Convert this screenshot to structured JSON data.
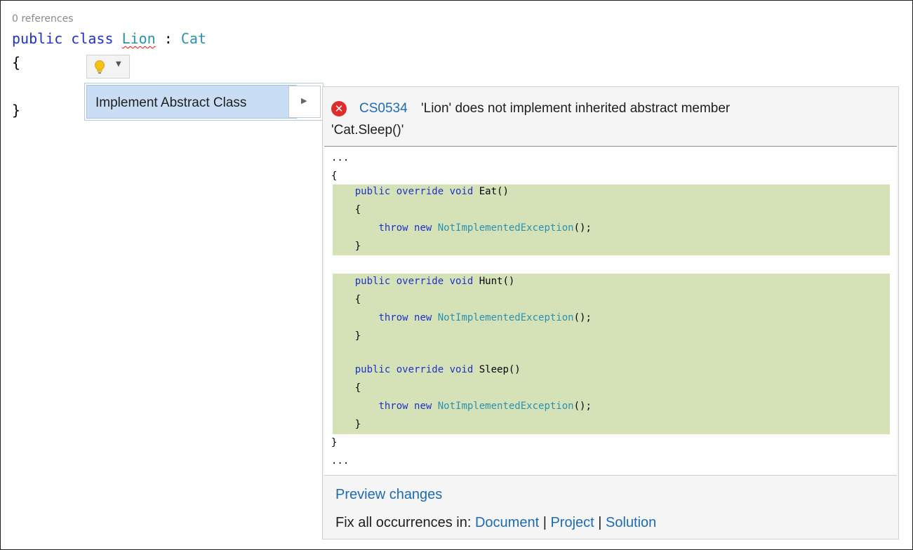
{
  "editor": {
    "codelens": "0 references",
    "lines": {
      "l1_kw1": "public",
      "l1_kw2": "class",
      "l1_class": "Lion",
      "l1_colon": ":",
      "l1_base": "Cat",
      "l2": "{",
      "l3": "}"
    }
  },
  "lightbulb": {
    "icon": "lightbulb-icon",
    "dropdown_icon": "chevron-down-icon"
  },
  "action_menu": {
    "item_label": "Implement Abstract Class",
    "submenu_icon": "chevron-right-icon"
  },
  "preview_panel": {
    "diagnostic": {
      "icon": "error-icon",
      "code": "CS0534",
      "message_line1": "'Lion' does not implement inherited abstract member",
      "message_line2": "'Cat.Sleep()'"
    },
    "code": {
      "ellipsis_top": "...",
      "open_brace": "{",
      "close_brace": "}",
      "ellipsis_bottom": "...",
      "methods": [
        {
          "kw": "public override void",
          "name": "Eat()",
          "open": "{",
          "throw_kw": "throw new",
          "exception": "NotImplementedException",
          "tail": "();",
          "close": "}"
        },
        {
          "kw": "public override void",
          "name": "Hunt()",
          "open": "{",
          "throw_kw": "throw new",
          "exception": "NotImplementedException",
          "tail": "();",
          "close": "}"
        },
        {
          "kw": "public override void",
          "name": "Sleep()",
          "open": "{",
          "throw_kw": "throw new",
          "exception": "NotImplementedException",
          "tail": "();",
          "close": "}"
        }
      ]
    },
    "preview_changes_label": "Preview changes",
    "fix_all": {
      "prefix": "Fix all occurrences in:",
      "document": "Document",
      "project": "Project",
      "solution": "Solution",
      "separator": "|"
    }
  },
  "colors": {
    "keyword": "#1f31c9",
    "type": "#2b91af",
    "added_highlight": "#d5e2b8",
    "link": "#1e6ab3",
    "error": "#e02b2b"
  }
}
